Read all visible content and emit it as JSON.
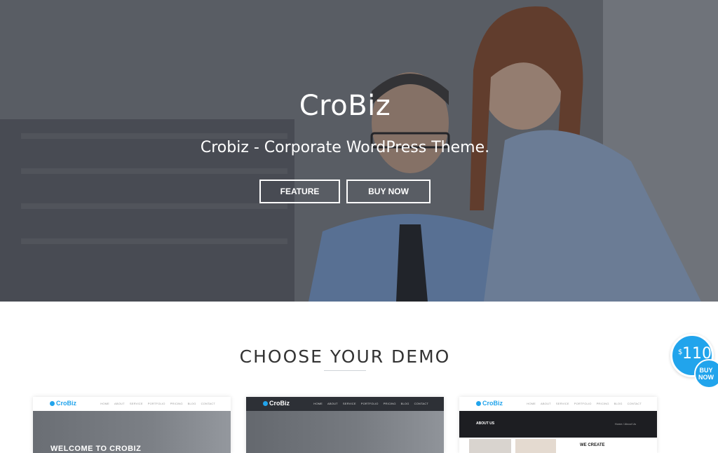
{
  "hero": {
    "title": "CroBiz",
    "subtitle": "Crobiz - Corporate WordPress Theme.",
    "buttons": {
      "feature": "FEATURE",
      "buy_now": "BUY NOW"
    }
  },
  "section": {
    "title": "CHOOSE YOUR DEMO"
  },
  "price_badge": {
    "currency": "$",
    "amount": "110",
    "buy_label": "BUY NOW"
  },
  "demos": [
    {
      "logo": "CroBiz",
      "menu": [
        "HOME",
        "ABOUT",
        "SERVICE",
        "PORTFOLIO",
        "PRICING",
        "BLOG",
        "CONTACT"
      ],
      "hero_text": "WELCOME TO CROBIZ"
    },
    {
      "logo": "CroBiz",
      "menu": [
        "HOME",
        "ABOUT",
        "SERVICE",
        "PORTFOLIO",
        "PRICING",
        "BLOG",
        "CONTACT"
      ]
    },
    {
      "logo": "CroBiz",
      "menu": [
        "HOME",
        "ABOUT",
        "SERVICE",
        "PORTFOLIO",
        "PRICING",
        "BLOG",
        "CONTACT"
      ],
      "page_title": "ABOUT US",
      "breadcrumb": "Home / About Us",
      "headline": "WE CREATE"
    }
  ],
  "colors": {
    "accent": "#21a4ec",
    "overlay": "#282c34",
    "heading": "#333333"
  }
}
